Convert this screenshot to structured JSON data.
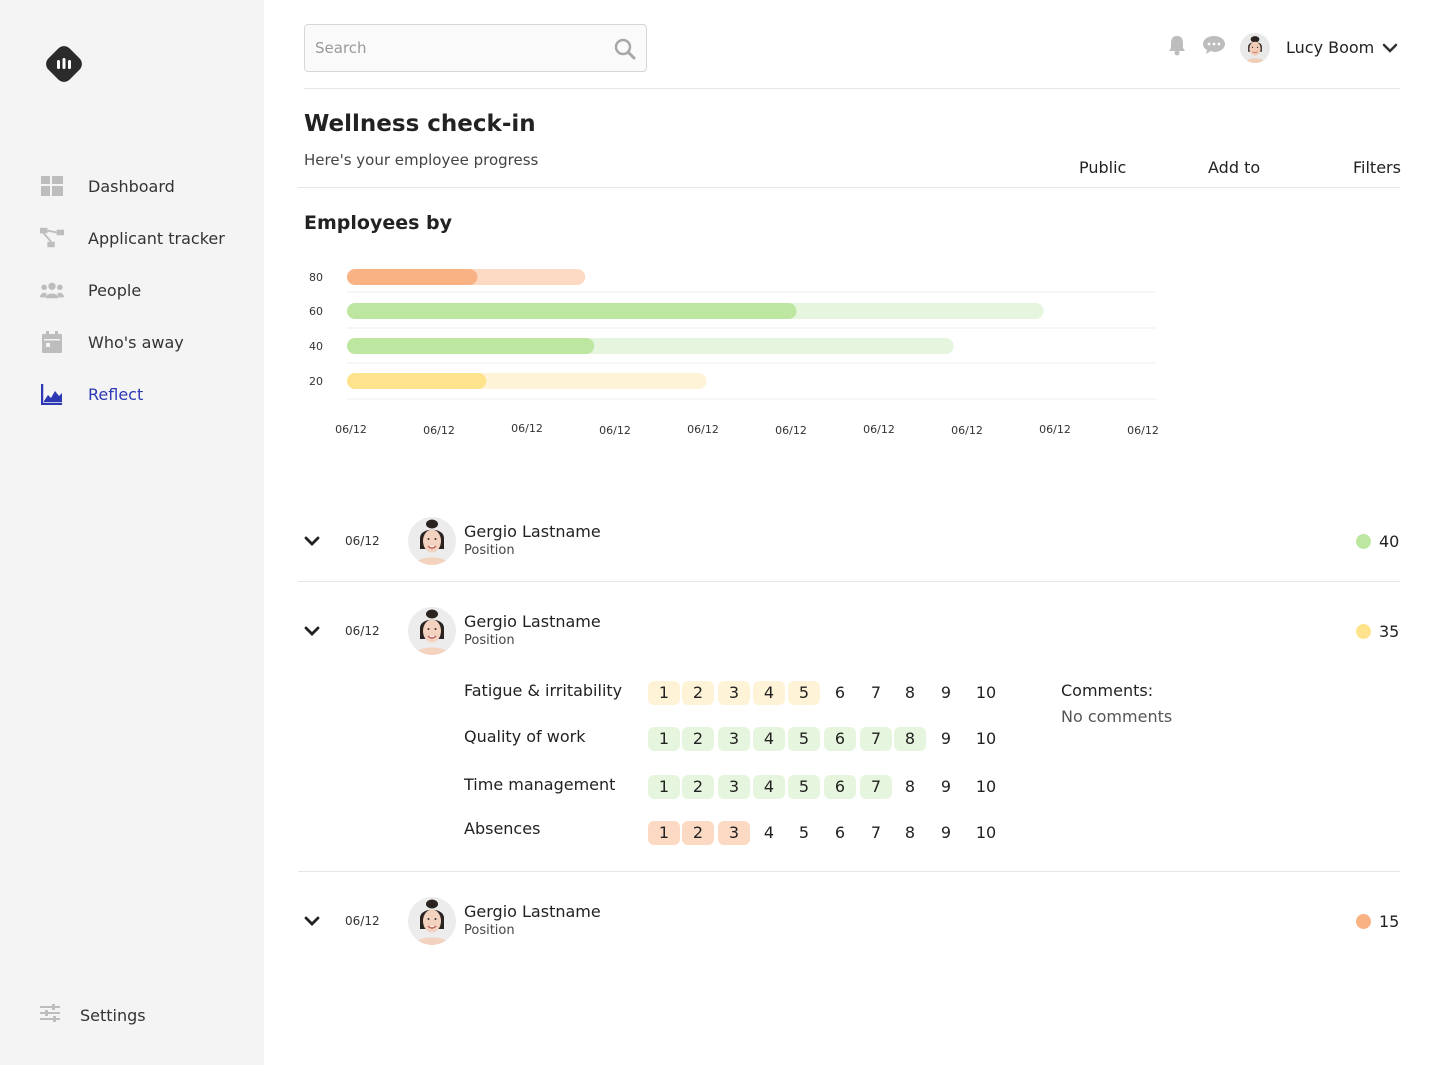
{
  "app": {
    "logo": "app-logo"
  },
  "sidebar": {
    "items": [
      {
        "label": "Dashboard",
        "icon": "dashboard-icon",
        "active": false
      },
      {
        "label": "Applicant tracker",
        "icon": "applicant-tracker-icon",
        "active": false
      },
      {
        "label": "People",
        "icon": "people-icon",
        "active": false
      },
      {
        "label": "Who's away",
        "icon": "calendar-icon",
        "active": false
      },
      {
        "label": "Reflect",
        "icon": "reflect-icon",
        "active": true
      }
    ],
    "settings_label": "Settings"
  },
  "header": {
    "search_placeholder": "Search",
    "user_name": "Lucy Boom"
  },
  "page": {
    "title": "Wellness check-in",
    "subtitle": "Here's your employee progress",
    "actions": {
      "public": "Public",
      "add_to": "Add to",
      "filters": "Filters"
    },
    "section_title": "Employees by"
  },
  "colors": {
    "accent": "#2d38b5",
    "green": "#bde6a1",
    "green_light": "#e6f5dd",
    "yellow": "#ffe38c",
    "yellow_light": "#fff3d7",
    "orange": "#f9b283",
    "orange_light": "#fcd9c3"
  },
  "chart_data": {
    "type": "bar",
    "orientation": "horizontal",
    "categories": [
      "80",
      "60",
      "40",
      "20"
    ],
    "series": [
      {
        "values": [
          29,
          100,
          55,
          31
        ]
      },
      {
        "values": [
          53,
          155,
          135,
          80
        ]
      }
    ],
    "x_tick_labels": [
      "06/12",
      "06/12",
      "06/12",
      "06/12",
      "06/12",
      "06/12",
      "06/12",
      "06/12",
      "06/12",
      "06/12"
    ],
    "grid": true
  },
  "employees": [
    {
      "date": "06/12",
      "name": "Gergio Lastname",
      "position": "Position",
      "score": "40",
      "status": "green",
      "expanded": false
    },
    {
      "date": "06/12",
      "name": "Gergio Lastname",
      "position": "Position",
      "score": "35",
      "status": "yellow",
      "expanded": true,
      "metrics": [
        {
          "label": "Fatigue & irritability",
          "filled": 5,
          "tone": "yellow"
        },
        {
          "label": "Quality of work",
          "filled": 8,
          "tone": "green"
        },
        {
          "label": "Time management",
          "filled": 7,
          "tone": "green"
        },
        {
          "label": "Absences",
          "filled": 3,
          "tone": "orange"
        }
      ],
      "comments_label": "Comments:",
      "comments": "No comments"
    },
    {
      "date": "06/12",
      "name": "Gergio Lastname",
      "position": "Position",
      "score": "15",
      "status": "orange",
      "expanded": false
    }
  ],
  "scale": [
    "1",
    "2",
    "3",
    "4",
    "5",
    "6",
    "7",
    "8",
    "9",
    "10"
  ]
}
